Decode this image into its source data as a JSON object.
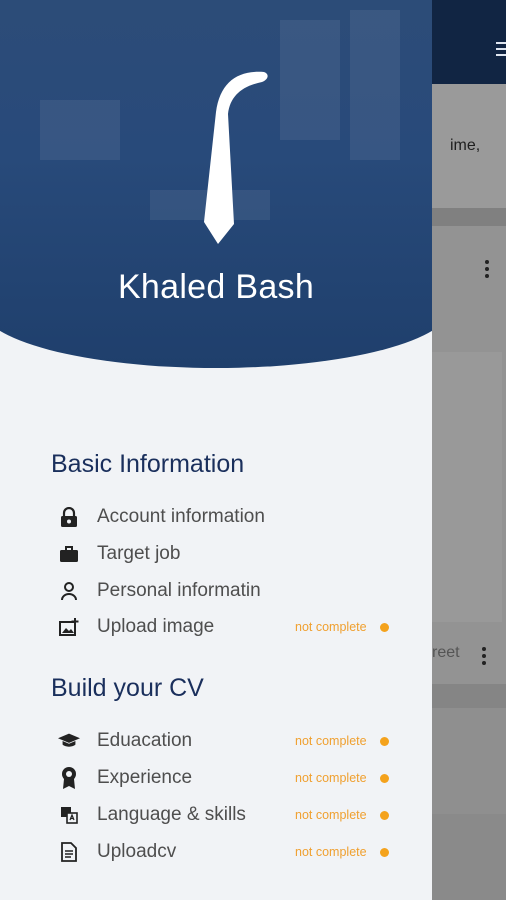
{
  "background_app": {
    "card_text_1": "ime,",
    "card_text_2": "reet"
  },
  "drawer": {
    "user_name": "Khaled Bash",
    "sections": [
      {
        "title": "Basic Information",
        "items": [
          {
            "label": "Account information",
            "icon": "lock-icon",
            "status": ""
          },
          {
            "label": "Target job",
            "icon": "briefcase-icon",
            "status": ""
          },
          {
            "label": "Personal informatin",
            "icon": "person-icon",
            "status": ""
          },
          {
            "label": "Upload image",
            "icon": "add-photo-icon",
            "status": "not complete"
          }
        ]
      },
      {
        "title": "Build your CV",
        "items": [
          {
            "label": "Eduacation",
            "icon": "graduation-cap-icon",
            "status": "not complete"
          },
          {
            "label": "Experience",
            "icon": "award-ribbon-icon",
            "status": "not complete"
          },
          {
            "label": "Language & skills",
            "icon": "translate-icon",
            "status": "not complete"
          },
          {
            "label": "Uploadcv",
            "icon": "document-icon",
            "status": "not complete"
          }
        ]
      }
    ]
  },
  "colors": {
    "header_blue": "#284a7a",
    "title_navy": "#1a2f5c",
    "status_orange": "#f4a21c",
    "drawer_bg": "#f1f3f6"
  }
}
